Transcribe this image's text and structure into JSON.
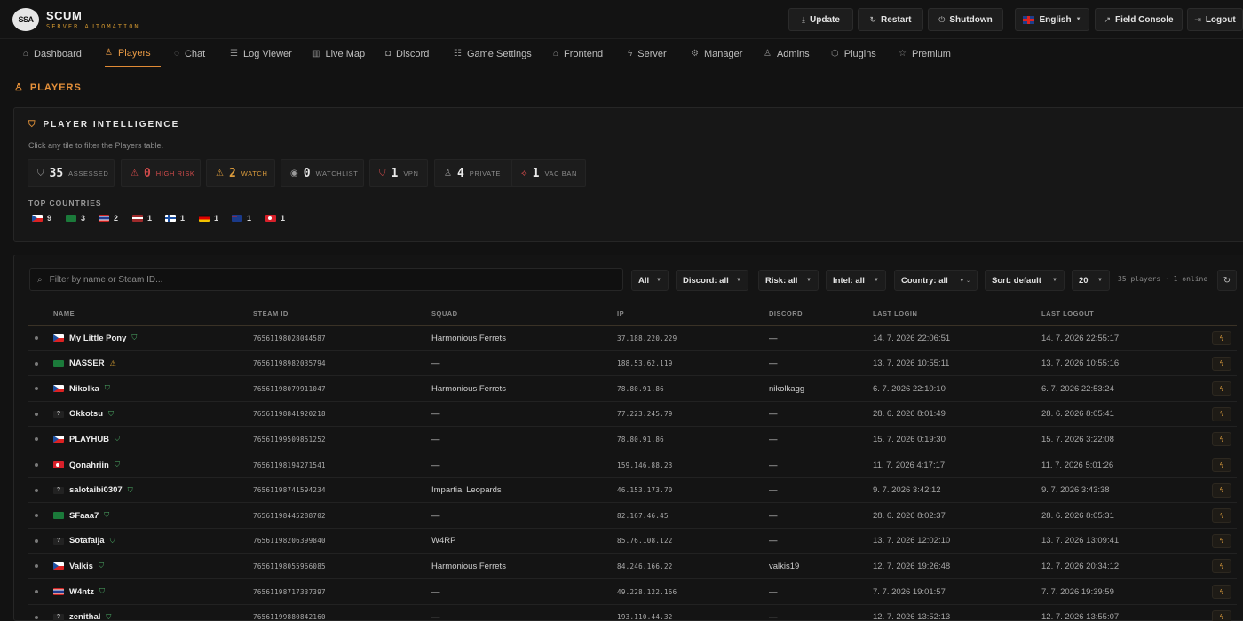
{
  "brand": {
    "logo_text": "SSA",
    "name": "SCUM",
    "subtitle": "SERVER AUTOMATION"
  },
  "top_actions": {
    "update": "Update",
    "restart": "Restart",
    "shutdown": "Shutdown",
    "language": "English",
    "field_console": "Field Console",
    "logout": "Logout"
  },
  "nav": [
    {
      "label": "Dashboard",
      "icon": "home-icon"
    },
    {
      "label": "Players",
      "icon": "user-icon",
      "active": true
    },
    {
      "label": "Chat",
      "icon": "chat-icon"
    },
    {
      "label": "Log Viewer",
      "icon": "list-icon"
    },
    {
      "label": "Live Map",
      "icon": "map-icon"
    },
    {
      "label": "Discord",
      "icon": "discord-icon"
    },
    {
      "label": "Game Settings",
      "icon": "sliders-icon"
    },
    {
      "label": "Frontend",
      "icon": "house-icon"
    },
    {
      "label": "Server",
      "icon": "bolt-icon"
    },
    {
      "label": "Manager",
      "icon": "gear-icon"
    },
    {
      "label": "Admins",
      "icon": "admin-icon"
    },
    {
      "label": "Plugins",
      "icon": "cube-icon"
    },
    {
      "label": "Premium",
      "icon": "star-icon"
    }
  ],
  "page": {
    "title": "PLAYERS"
  },
  "intel": {
    "title": "PLAYER INTELLIGENCE",
    "hint": "Click any tile to filter the Players table.",
    "tiles": [
      {
        "value": "35",
        "label": "ASSESSED"
      },
      {
        "value": "0",
        "label": "HIGH RISK"
      },
      {
        "value": "2",
        "label": "WATCH"
      },
      {
        "value": "0",
        "label": "WATCHLIST"
      },
      {
        "value": "1",
        "label": "VPN"
      },
      {
        "value": "4",
        "label": "PRIVATE"
      },
      {
        "value": "1",
        "label": "VAC BAN"
      }
    ],
    "countries_label": "TOP COUNTRIES",
    "countries": [
      {
        "code": "cz",
        "count": "9"
      },
      {
        "code": "sa",
        "count": "3"
      },
      {
        "code": "th",
        "count": "2"
      },
      {
        "code": "lv",
        "count": "1"
      },
      {
        "code": "fi",
        "count": "1"
      },
      {
        "code": "de",
        "count": "1"
      },
      {
        "code": "au",
        "count": "1"
      },
      {
        "code": "tr",
        "count": "1"
      }
    ]
  },
  "filters": {
    "search_placeholder": "Filter by name or Steam ID...",
    "all": "All",
    "discord": "Discord: all",
    "risk": "Risk: all",
    "intel": "Intel: all",
    "country": "Country: all",
    "sort": "Sort: default",
    "page_size": "20",
    "count_text": "35 players · 1 online"
  },
  "table": {
    "headers": [
      "NAME",
      "STEAM ID",
      "SQUAD",
      "IP",
      "DISCORD",
      "LAST LOGIN",
      "LAST LOGOUT"
    ],
    "rows": [
      {
        "flag": "cz",
        "name": "My Little Pony",
        "badge": "ok",
        "steam": "76561198028044587",
        "squad": "Harmonious Ferrets",
        "ip": "37.188.220.229",
        "discord": "—",
        "login": "14. 7. 2026 22:06:51",
        "logout": "14. 7. 2026 22:55:17"
      },
      {
        "flag": "sa",
        "name": "NASSER",
        "badge": "warn",
        "steam": "76561198982035794",
        "squad": "—",
        "ip": "188.53.62.119",
        "discord": "—",
        "login": "13. 7. 2026 10:55:11",
        "logout": "13. 7. 2026 10:55:16"
      },
      {
        "flag": "cz",
        "name": "Nikolka",
        "badge": "ok",
        "steam": "76561198079911047",
        "squad": "Harmonious Ferrets",
        "ip": "78.80.91.86",
        "discord": "nikolkagg",
        "login": "6. 7. 2026 22:10:10",
        "logout": "6. 7. 2026 22:53:24"
      },
      {
        "flag": "unknown",
        "name": "Okkotsu",
        "badge": "ok",
        "steam": "76561198841920218",
        "squad": "—",
        "ip": "77.223.245.79",
        "discord": "—",
        "login": "28. 6. 2026 8:01:49",
        "logout": "28. 6. 2026 8:05:41"
      },
      {
        "flag": "cz",
        "name": "PLAYHUB",
        "badge": "ok",
        "steam": "76561199509851252",
        "squad": "—",
        "ip": "78.80.91.86",
        "discord": "—",
        "login": "15. 7. 2026 0:19:30",
        "logout": "15. 7. 2026 3:22:08"
      },
      {
        "flag": "tr",
        "name": "Qonahriin",
        "badge": "ok",
        "steam": "76561198194271541",
        "squad": "—",
        "ip": "159.146.88.23",
        "discord": "—",
        "login": "11. 7. 2026 4:17:17",
        "logout": "11. 7. 2026 5:01:26"
      },
      {
        "flag": "unknown",
        "name": "salotaibi0307",
        "badge": "ok",
        "steam": "76561198741594234",
        "squad": "Impartial Leopards",
        "ip": "46.153.173.70",
        "discord": "—",
        "login": "9. 7. 2026 3:42:12",
        "logout": "9. 7. 2026 3:43:38"
      },
      {
        "flag": "sa",
        "name": "SFaaa7",
        "badge": "ok",
        "steam": "76561198445288702",
        "squad": "—",
        "ip": "82.167.46.45",
        "discord": "—",
        "login": "28. 6. 2026 8:02:37",
        "logout": "28. 6. 2026 8:05:31"
      },
      {
        "flag": "unknown",
        "name": "Sotafaija",
        "badge": "ok",
        "steam": "76561198206399840",
        "squad": "W4RP",
        "ip": "85.76.108.122",
        "discord": "—",
        "login": "13. 7. 2026 12:02:10",
        "logout": "13. 7. 2026 13:09:41"
      },
      {
        "flag": "cz",
        "name": "Valkis",
        "badge": "ok",
        "steam": "76561198055966085",
        "squad": "Harmonious Ferrets",
        "ip": "84.246.166.22",
        "discord": "valkis19",
        "login": "12. 7. 2026 19:26:48",
        "logout": "12. 7. 2026 20:34:12"
      },
      {
        "flag": "th",
        "name": "W4ntz",
        "badge": "ok",
        "steam": "76561198717337397",
        "squad": "—",
        "ip": "49.228.122.166",
        "discord": "—",
        "login": "7. 7. 2026 19:01:57",
        "logout": "7. 7. 2026 19:39:59"
      },
      {
        "flag": "unknown",
        "name": "zenithal",
        "badge": "ok",
        "steam": "76561199880842160",
        "squad": "—",
        "ip": "193.110.44.32",
        "discord": "—",
        "login": "12. 7. 2026 13:52:13",
        "logout": "12. 7. 2026 13:55:07"
      }
    ]
  },
  "colors": {
    "accent": "#e5903a",
    "risk": "#d24b4b",
    "watch": "#d99a3c",
    "ok": "#4fb36a"
  }
}
